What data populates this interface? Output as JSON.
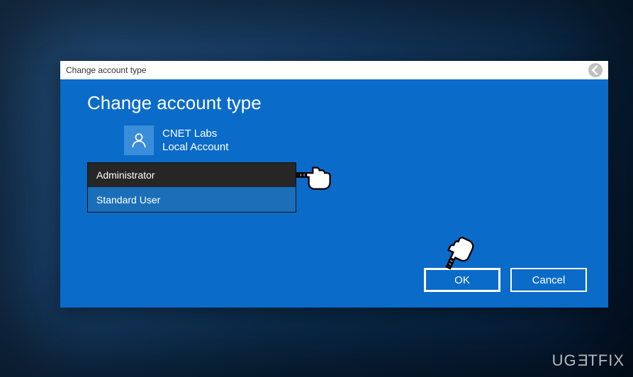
{
  "titlebar": {
    "title": "Change account type"
  },
  "heading": "Change account type",
  "account": {
    "name": "CNET Labs",
    "type": "Local Account"
  },
  "dropdown": {
    "options": [
      {
        "label": "Administrator"
      },
      {
        "label": "Standard User"
      }
    ]
  },
  "buttons": {
    "ok": "OK",
    "cancel": "Cancel"
  },
  "watermark": "UGETFIX"
}
